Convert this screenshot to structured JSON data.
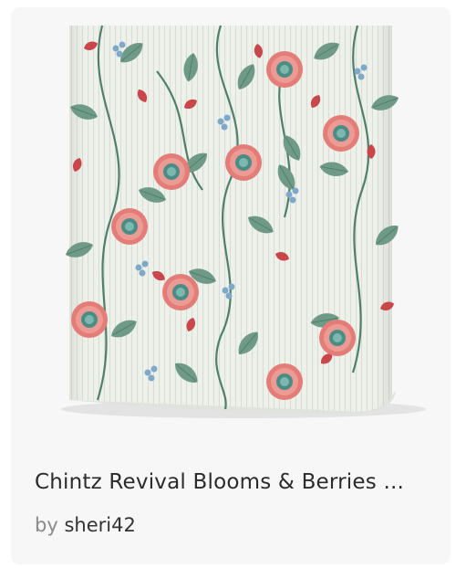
{
  "product": {
    "title": "Chintz Revival Blooms & Berries ...",
    "by_prefix": "by",
    "designer": "sheri42",
    "image_subject": "wallpaper-roll-preview"
  },
  "colors": {
    "background": "#eef0ea",
    "leaf": "#6f9a87",
    "leaf_dark": "#4f7f6d",
    "flower": "#e47c78",
    "flower_center": "#4b8c86",
    "berry": "#7fa9c9",
    "red_accent": "#c9474a"
  }
}
